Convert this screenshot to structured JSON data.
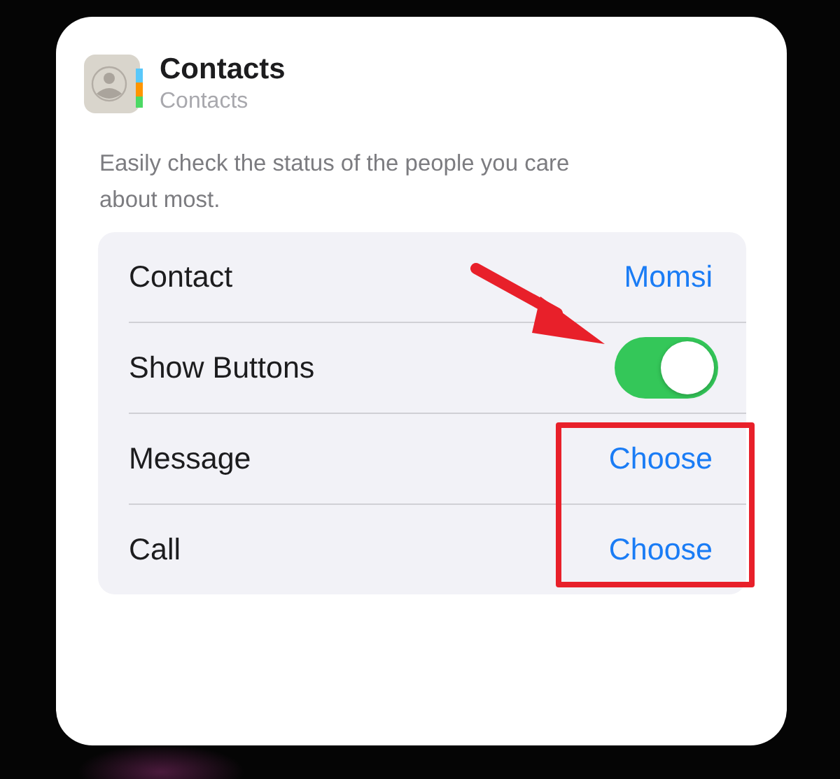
{
  "widget": {
    "title": "Contacts",
    "subtitle": "Contacts",
    "description": "Easily check the status of the people you care about most."
  },
  "settings": [
    {
      "kind": "value",
      "label": "Contact",
      "value": "Momsi"
    },
    {
      "kind": "toggle",
      "label": "Show Buttons",
      "on": true
    },
    {
      "kind": "value",
      "label": "Message",
      "value": "Choose"
    },
    {
      "kind": "value",
      "label": "Call",
      "value": "Choose"
    }
  ],
  "annotations": {
    "arrow": true,
    "highlight_frame": true
  }
}
